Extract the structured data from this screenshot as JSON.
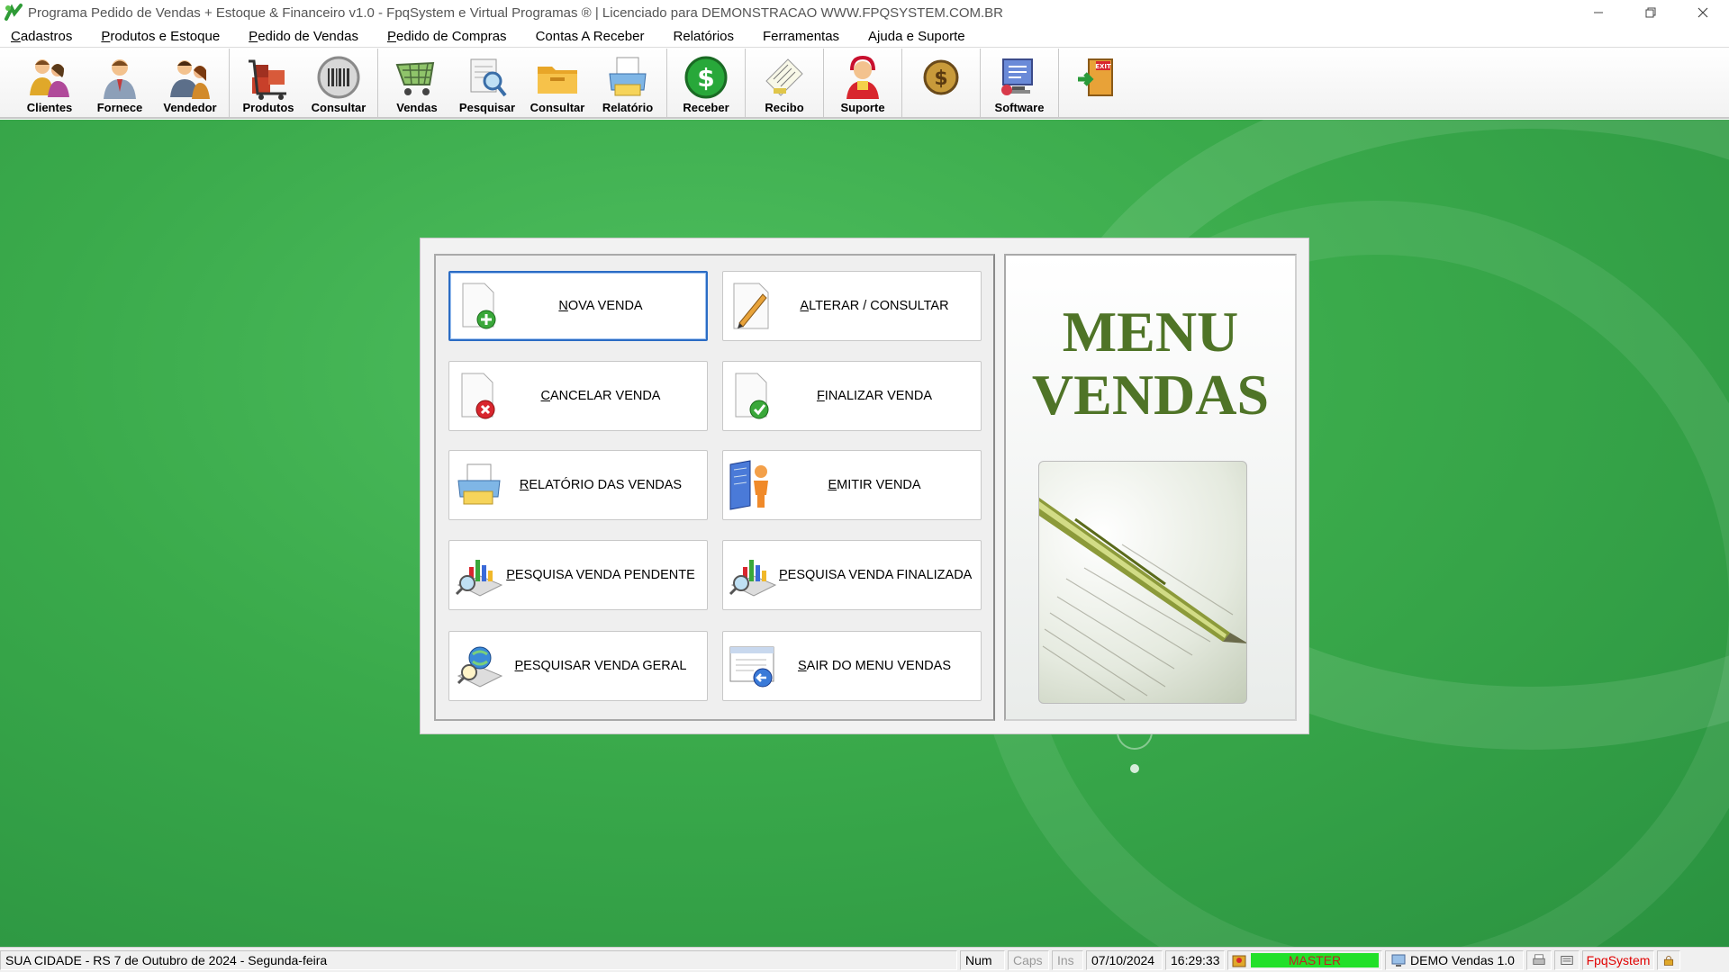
{
  "window": {
    "title": "Programa Pedido de Vendas + Estoque & Financeiro v1.0 - FpqSystem e Virtual Programas ® | Licenciado para  DEMONSTRACAO WWW.FPQSYSTEM.COM.BR"
  },
  "menubar": {
    "items": [
      {
        "underline": "C",
        "rest": "adastros"
      },
      {
        "underline": "P",
        "rest": "rodutos e Estoque"
      },
      {
        "underline": "P",
        "rest": "edido de Vendas"
      },
      {
        "underline": "P",
        "rest": "edido de Compras"
      },
      {
        "underline": "",
        "rest": "Contas A Receber"
      },
      {
        "underline": "",
        "rest": "Relatórios"
      },
      {
        "underline": "",
        "rest": "Ferramentas"
      },
      {
        "underline": "",
        "rest": "Ajuda e Suporte"
      }
    ]
  },
  "toolbar": {
    "buttons": [
      {
        "label": "Clientes",
        "icon": "clients-icon"
      },
      {
        "label": "Fornece",
        "icon": "supplier-icon"
      },
      {
        "label": "Vendedor",
        "icon": "seller-icon"
      },
      {
        "label": "Produtos",
        "icon": "products-icon"
      },
      {
        "label": "Consultar",
        "icon": "barcode-icon"
      },
      {
        "label": "Vendas",
        "icon": "cart-icon"
      },
      {
        "label": "Pesquisar",
        "icon": "search-doc-icon"
      },
      {
        "label": "Consultar",
        "icon": "folder-icon"
      },
      {
        "label": "Relatório",
        "icon": "report-icon"
      },
      {
        "label": "Receber",
        "icon": "dollar-icon"
      },
      {
        "label": "Recibo",
        "icon": "receipt-icon"
      },
      {
        "label": "Suporte",
        "icon": "support-icon"
      },
      {
        "label": "",
        "icon": "coins-icon"
      },
      {
        "label": "Software",
        "icon": "software-icon"
      },
      {
        "label": "",
        "icon": "exit-icon"
      }
    ]
  },
  "menu_vendas": {
    "title_line1": "MENU",
    "title_line2": "VENDAS",
    "buttons": [
      {
        "underline": "N",
        "rest": "OVA VENDA",
        "icon": "new-doc-icon"
      },
      {
        "underline": "A",
        "rest": "LTERAR / CONSULTAR",
        "icon": "pencil-icon"
      },
      {
        "underline": "C",
        "rest": "ANCELAR VENDA",
        "icon": "cancel-doc-icon"
      },
      {
        "underline": "F",
        "rest": "INALIZAR VENDA",
        "icon": "check-doc-icon"
      },
      {
        "underline": "R",
        "rest": "ELATÓRIO DAS VENDAS",
        "icon": "printer-icon"
      },
      {
        "underline": "E",
        "rest": "MITIR VENDA",
        "icon": "person-book-icon"
      },
      {
        "underline": "P",
        "rest": "ESQUISA VENDA PENDENTE",
        "icon": "chart-search-icon"
      },
      {
        "underline": "P",
        "rest": "ESQUISA VENDA FINALIZADA",
        "icon": "chart-search-icon"
      },
      {
        "underline": "P",
        "rest": "ESQUISAR VENDA GERAL",
        "icon": "globe-search-icon"
      },
      {
        "underline": "S",
        "rest": "AIR DO MENU VENDAS",
        "icon": "exit-window-icon"
      }
    ]
  },
  "statusbar": {
    "location": "SUA CIDADE - RS  7 de Outubro de 2024 - Segunda-feira",
    "num": "Num",
    "caps": "Caps",
    "ins": "Ins",
    "date": "07/10/2024",
    "time": "16:29:33",
    "user": "MASTER",
    "version": "DEMO Vendas 1.0",
    "brand": "FpqSystem",
    "user_color": "#22e02a",
    "brand_color": "#e00000"
  }
}
